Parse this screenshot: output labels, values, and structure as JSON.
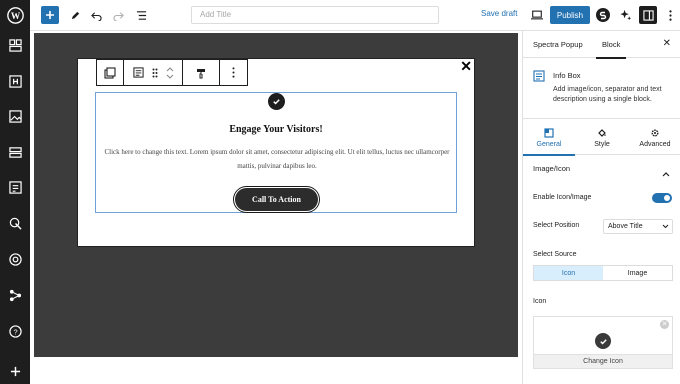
{
  "toolbar": {
    "title_placeholder": "Add Title",
    "save_draft_label": "Save draft",
    "publish_label": "Publish"
  },
  "popup": {
    "infobox": {
      "title": "Engage Your Visitors!",
      "description": "Click here to change this text. Lorem ipsum dolor sit amet, consectetur adipiscing elit. Ut elit tellus, luctus nec ullamcorper mattis, pulvinar dapibus leo.",
      "cta_label": "Call To Action"
    }
  },
  "sidebar": {
    "tabs": [
      "Spectra Popup",
      "Block"
    ],
    "block": {
      "name": "Info Box",
      "description": "Add image/icon, separator and text description using a single block."
    },
    "subtabs": [
      "General",
      "Style",
      "Advanced"
    ],
    "section_title": "Image/Icon",
    "enable_label": "Enable Icon/Image",
    "enable_value": true,
    "position_label": "Select Position",
    "position_value": "Above Title",
    "source_label": "Select Source",
    "source_options": [
      "Icon",
      "Image"
    ],
    "source_selected": "Icon",
    "icon_label": "Icon",
    "change_icon_label": "Change Icon"
  },
  "colors": {
    "accent": "#2271b1",
    "rail": "#1e1e1e",
    "canvas": "#3c3c3c"
  }
}
